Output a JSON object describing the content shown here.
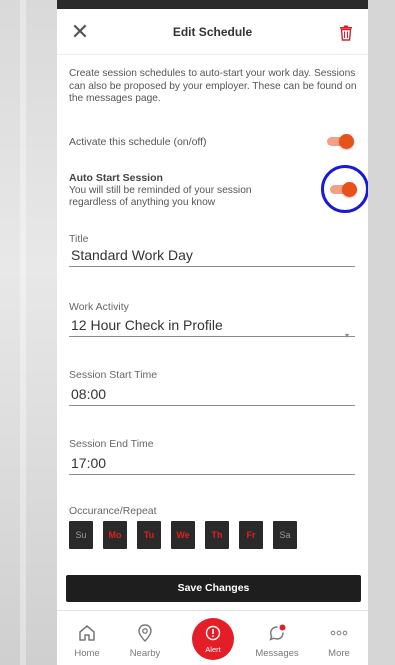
{
  "header": {
    "title": "Edit Schedule",
    "close_icon": "close-icon",
    "delete_icon": "trash-icon",
    "accent_color": "#e41e26"
  },
  "intro_text": "Create session schedules to auto-start your work day. Sessions can also be proposed by your employer. These can be found on the messages page.",
  "activate": {
    "label": "Activate this schedule (on/off)",
    "on": true
  },
  "auto_start": {
    "title": "Auto Start Session",
    "subtitle": "You will still be reminded of your session regardless of anything you know",
    "on": true
  },
  "fields": {
    "title": {
      "label": "Title",
      "value": "Standard Work Day"
    },
    "activity": {
      "label": "Work Activity",
      "value": "12 Hour Check in Profile"
    },
    "start": {
      "label": "Session Start Time",
      "value": "08:00"
    },
    "end": {
      "label": "Session End Time",
      "value": "17:00"
    }
  },
  "repeat": {
    "label": "Occurance/Repeat",
    "days": [
      {
        "label": "Su",
        "active": false
      },
      {
        "label": "Mo",
        "active": true
      },
      {
        "label": "Tu",
        "active": true
      },
      {
        "label": "We",
        "active": true
      },
      {
        "label": "Th",
        "active": true
      },
      {
        "label": "Fr",
        "active": true
      },
      {
        "label": "Sa",
        "active": false
      }
    ]
  },
  "save_label": "Save Changes",
  "tabs": [
    {
      "label": "Home",
      "icon": "home-icon"
    },
    {
      "label": "Nearby",
      "icon": "location-pin-icon"
    },
    {
      "label": "Alert",
      "icon": "alert-icon"
    },
    {
      "label": "Messages",
      "icon": "message-icon"
    },
    {
      "label": "More",
      "icon": "more-icon"
    }
  ],
  "colors": {
    "toggle_knob": "#e8511a",
    "toggle_track": "#f3a183",
    "day_active_text": "#e0201a",
    "highlight_ring": "#1a1ad6"
  }
}
